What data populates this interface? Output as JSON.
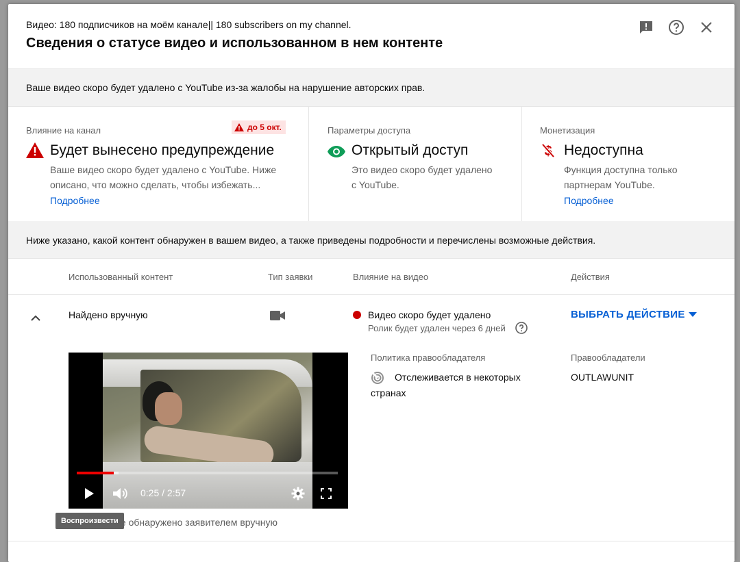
{
  "header": {
    "subtitle": "Видео: 180 подписчиков на моём канале|| 180 subscribers on my channel.",
    "title": "Сведения о статусе видео и использованном в нем контенте"
  },
  "banner": {
    "text": "Ваше видео скоро будет удалено с YouTube из-за жалобы на нарушение авторских прав."
  },
  "cards": {
    "impact": {
      "label": "Влияние на канал",
      "badge": "до 5 окт.",
      "value": "Будет вынесено предупреждение",
      "desc_line1": "Ваше видео скоро будет удалено с YouTube. Ниже",
      "desc_line2": "описано, что можно сделать, чтобы избежать...",
      "link": "Подробнее",
      "icon": "warning-triangle-icon",
      "color": "#cc0000"
    },
    "access": {
      "label": "Параметры доступа",
      "value": "Открытый доступ",
      "desc_line1": "Это видео скоро будет удалено",
      "desc_line2": "с YouTube.",
      "icon": "eye-icon",
      "color": "#0f9d58"
    },
    "monetization": {
      "label": "Монетизация",
      "value": "Недоступна",
      "desc_line1": "Функция доступна только",
      "desc_line2": "партнерам YouTube.",
      "link": "Подробнее",
      "icon": "dollar-off-icon",
      "color": "#cc0000"
    }
  },
  "info_banner": {
    "text": "Ниже указано, какой контент обнаружен в вашем видео, а также приведены подробности и перечислены возможные действия."
  },
  "table": {
    "headers": [
      "Использованный контент",
      "Тип заявки",
      "Влияние на видео",
      "Действия"
    ],
    "row": {
      "content": "Найдено вручную",
      "claim_type_icon": "video-camera-icon",
      "impact": "Видео скоро будет удалено",
      "impact_sub": "Ролик будет удален через 6 дней",
      "action": "ВЫБРАТЬ ДЕЙСТВИЕ"
    }
  },
  "details": {
    "policy_label": "Политика правообладателя",
    "policy_line1": "Отслеживается в некоторых",
    "policy_line2": "странах",
    "owners_label": "Правообладатели",
    "owner": "OUTLAWUNIT",
    "caption": "Содержимое обнаружено заявителем вручную"
  },
  "player": {
    "time": "0:25 / 2:57",
    "progress": 0.141,
    "tooltip": "Воспроизвести"
  }
}
